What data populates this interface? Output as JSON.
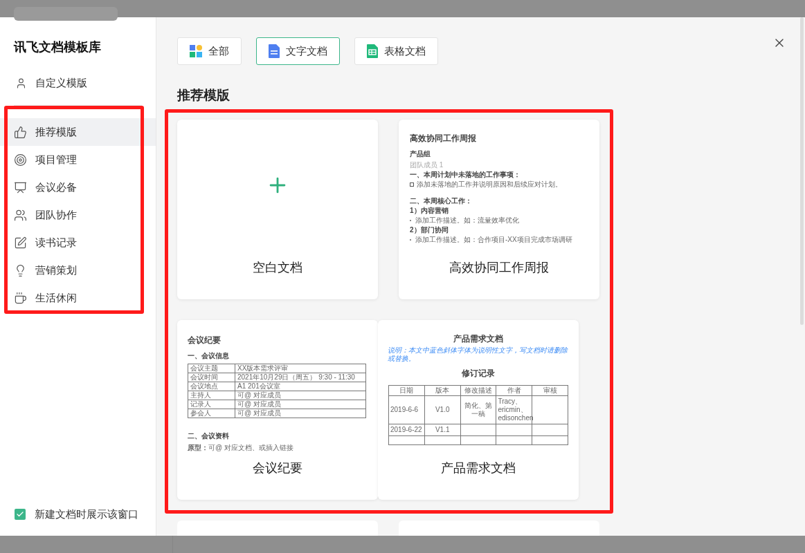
{
  "sidebar": {
    "title": "讯飞文档模板库",
    "custom_item": {
      "label": "自定义模版"
    },
    "categories": [
      {
        "label": "推荐模版",
        "selected": true
      },
      {
        "label": "项目管理",
        "selected": false
      },
      {
        "label": "会议必备",
        "selected": false
      },
      {
        "label": "团队协作",
        "selected": false
      },
      {
        "label": "读书记录",
        "selected": false
      },
      {
        "label": "营销策划",
        "selected": false
      },
      {
        "label": "生活休闲",
        "selected": false
      }
    ],
    "show_on_new": {
      "label": "新建文档时展示该窗口",
      "checked": true
    }
  },
  "filters": [
    {
      "label": "全部",
      "kind": "all",
      "selected": false
    },
    {
      "label": "文字文档",
      "kind": "doc",
      "selected": true
    },
    {
      "label": "表格文档",
      "kind": "sheet",
      "selected": false
    }
  ],
  "section_title": "推荐模版",
  "templates": [
    {
      "name": "空白文档",
      "kind": "blank"
    },
    {
      "name": "高效协同工作周报",
      "kind": "weekly",
      "preview": {
        "title": "高效协同工作周报",
        "lines": [
          {
            "kind": "heading",
            "text": "产品组"
          },
          {
            "kind": "muted",
            "text": "团队成员 1"
          },
          {
            "kind": "strong",
            "text": "一、本周计划中未落地的工作事项："
          },
          {
            "kind": "checkbox",
            "text": "添加未落地的工作并说明原因和后续应对计划。"
          },
          {
            "kind": "gap"
          },
          {
            "kind": "strong",
            "text": "二、本周核心工作："
          },
          {
            "kind": "strong",
            "text": "1）内容营销"
          },
          {
            "kind": "bullet",
            "text": "添加工作描述。如：流量效率优化"
          },
          {
            "kind": "strong",
            "text": "2）部门协同"
          },
          {
            "kind": "bullet",
            "text": "添加工作描述。如：合作项目-XX项目完成市场调研"
          }
        ]
      }
    },
    {
      "name": "会议纪要",
      "kind": "meeting",
      "preview": {
        "title": "会议纪要",
        "section_1": "一、会议信息",
        "rows": [
          [
            "会议主题",
            "XX版本需求评审"
          ],
          [
            "会议时间",
            "2021年10月29日（周五） 9:30 - 11:30"
          ],
          [
            "会议地点",
            "A1 201会议室"
          ],
          [
            "主持人",
            "可@ 对应成员"
          ],
          [
            "记录人",
            "可@ 对应成员"
          ],
          [
            "参会人",
            "可@ 对应成员"
          ]
        ],
        "section_2": "二、会议资料",
        "note": "**原型：**可@ 对应文档、或插入链接"
      }
    },
    {
      "name": "产品需求文档",
      "kind": "prd",
      "preview": {
        "title": "产品需求文档",
        "note": "说明：本文中蓝色斜体字体为说明性文字，写文档时请删除或替换。",
        "subtitle": "修订记录",
        "columns": [
          "日期",
          "版本",
          "修改描述",
          "作者",
          "审核"
        ],
        "rows": [
          [
            "2019-6-6",
            "V1.0",
            "简化、第一稿",
            "Tracy、 ericmin、 edisonchen",
            null
          ],
          [
            "2019-6-22",
            "V1.1",
            null,
            null,
            null
          ],
          [
            null,
            null,
            null,
            null,
            null
          ]
        ]
      }
    }
  ]
}
